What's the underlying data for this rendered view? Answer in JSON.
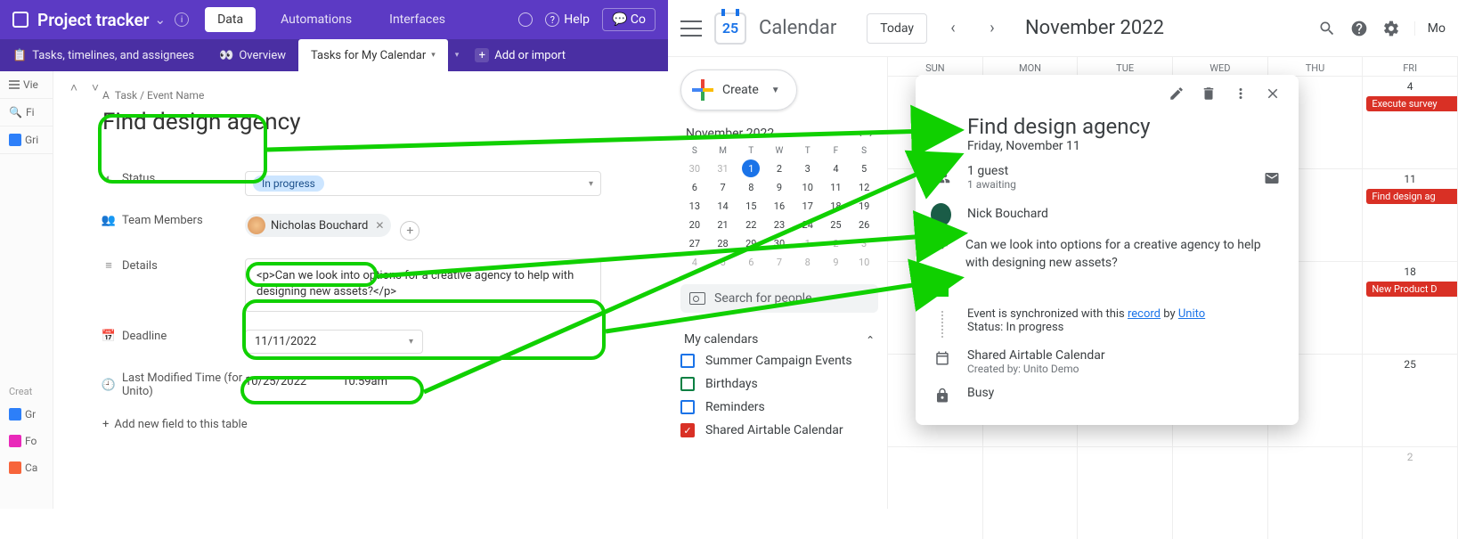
{
  "airtable": {
    "base_title": "Project tracker",
    "top_tabs": {
      "data": "Data",
      "automations": "Automations",
      "interfaces": "Interfaces"
    },
    "help": "Help",
    "share_prefix": "Co",
    "tables": {
      "t1": "Tasks, timelines, and assignees",
      "t2": "Overview",
      "t3": "Tasks for My Calendar",
      "add_import": "Add or import"
    },
    "left": {
      "views": "Vie",
      "find": "Fi",
      "grid": "Gri",
      "create": "Creat",
      "grid2": "Gr",
      "form": "Fo",
      "cal": "Ca"
    },
    "fields": {
      "task_label": "Task / Event Name",
      "task_value": "Find design agency",
      "status_label": "Status",
      "status_value": "In progress",
      "members_label": "Team Members",
      "member_name": "Nicholas Bouchard",
      "details_label": "Details",
      "details_value": "<p>Can we look into options for a creative agency to help with designing new assets?</p>",
      "deadline_label": "Deadline",
      "deadline_value": "11/11/2022",
      "lastmod_label": "Last Modified Time (for Unito)",
      "lastmod_date": "10/25/2022",
      "lastmod_time": "10:59am",
      "add_field": "Add new field to this table"
    }
  },
  "gcal": {
    "product": "Calendar",
    "logo_day": "25",
    "today": "Today",
    "month_label": "November 2022",
    "more": "Mo",
    "create": "Create",
    "mini": {
      "title": "November 2022",
      "dows": [
        "S",
        "M",
        "T",
        "W",
        "T",
        "F",
        "S"
      ],
      "weeks": [
        [
          {
            "n": "30",
            "dim": true
          },
          {
            "n": "31",
            "dim": true
          },
          {
            "n": "1",
            "today": true
          },
          {
            "n": "2"
          },
          {
            "n": "3"
          },
          {
            "n": "4"
          },
          {
            "n": "5"
          }
        ],
        [
          {
            "n": "6"
          },
          {
            "n": "7"
          },
          {
            "n": "8"
          },
          {
            "n": "9"
          },
          {
            "n": "10"
          },
          {
            "n": "11"
          },
          {
            "n": "12"
          }
        ],
        [
          {
            "n": "13"
          },
          {
            "n": "14"
          },
          {
            "n": "15"
          },
          {
            "n": "16"
          },
          {
            "n": "17"
          },
          {
            "n": "18"
          },
          {
            "n": "19"
          }
        ],
        [
          {
            "n": "20"
          },
          {
            "n": "21"
          },
          {
            "n": "22"
          },
          {
            "n": "23"
          },
          {
            "n": "24"
          },
          {
            "n": "25"
          },
          {
            "n": "26"
          }
        ],
        [
          {
            "n": "27"
          },
          {
            "n": "28"
          },
          {
            "n": "29"
          },
          {
            "n": "30"
          },
          {
            "n": "1",
            "dim": true
          },
          {
            "n": "2",
            "dim": true
          },
          {
            "n": "3",
            "dim": true
          }
        ],
        [
          {
            "n": "4",
            "dim": true
          },
          {
            "n": "5",
            "dim": true
          },
          {
            "n": "6",
            "dim": true
          },
          {
            "n": "7",
            "dim": true
          },
          {
            "n": "8",
            "dim": true
          },
          {
            "n": "9",
            "dim": true
          },
          {
            "n": "10",
            "dim": true
          }
        ]
      ]
    },
    "search_people": "Search for people",
    "my_calendars": "My calendars",
    "calendars": [
      {
        "label": "Summer Campaign Events",
        "color": "#1a73e8",
        "checked": false
      },
      {
        "label": "Birthdays",
        "color": "#0b8043",
        "checked": false
      },
      {
        "label": "Reminders",
        "color": "#1a73e8",
        "checked": false
      },
      {
        "label": "Shared Airtable Calendar",
        "color": "#d93025",
        "checked": true
      }
    ],
    "grid": {
      "days": [
        "SUN",
        "MON",
        "TUE",
        "WED",
        "THU",
        "FRI"
      ],
      "rows": [
        {
          "fri": "4",
          "fri_ev": "Execute survey"
        },
        {
          "fri": "11",
          "fri_ev": "Find design ag"
        },
        {
          "fri": "18",
          "fri_ev": "New Product D"
        },
        {
          "fri": "25"
        },
        {
          "fri": "2",
          "dim": true
        }
      ]
    }
  },
  "event": {
    "title": "Find design agency",
    "date": "Friday, November 11",
    "guest_count": "1 guest",
    "guest_sub": "1 awaiting",
    "guest_name": "Nick Bouchard",
    "desc": "Can we look into options for a creative agency to help with designing new assets?",
    "sync_pre": "Event is synchronized with this ",
    "sync_link1": " record",
    "sync_mid": " by ",
    "sync_link2": "Unito",
    "sync_status": "Status: In progress",
    "cal_name": "Shared Airtable Calendar",
    "created_by": "Created by: Unito Demo",
    "busy": "Busy"
  }
}
